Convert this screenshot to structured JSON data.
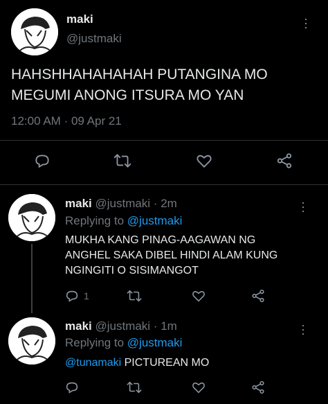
{
  "main_tweet": {
    "name": "maki",
    "handle": "@justmaki",
    "text_line1": "HAHSHHAHAHAHAH PUTANGINA MO",
    "text_line2": "MEGUMI ANONG ITSURA MO YAN",
    "time": "12:00 AM",
    "separator": "·",
    "date": "09 Apr 21"
  },
  "replies": [
    {
      "name": "maki",
      "handle_time": "@justmaki · 2m",
      "replying_prefix": "Replying to",
      "replying_to": "@justmaki",
      "text_line1": "MUKHA KANG PINAG-AAGAWAN NG",
      "text_line2": "ANGHEL SAKA DIBEL HINDI ALAM KUNG",
      "text_line3": "NGINGITI O SISIMANGOT",
      "reply_count": "1"
    },
    {
      "name": "maki",
      "handle_time": "@justmaki · 1m",
      "replying_prefix": "Replying to",
      "replying_to": "@justmaki",
      "mention": "@tunamaki",
      "text": "PICTUREAN MO"
    }
  ],
  "colors": {
    "background": "#000000",
    "text": "#e7e9ea",
    "muted": "#71767b",
    "link": "#1d9bf0",
    "divider": "#2f3336"
  },
  "icons": [
    "more-options-icon",
    "reply-icon",
    "retweet-icon",
    "like-icon",
    "share-icon"
  ]
}
